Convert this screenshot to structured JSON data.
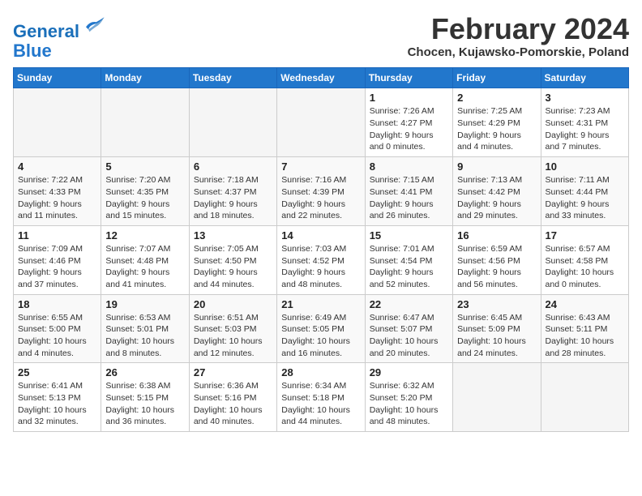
{
  "header": {
    "logo_line1": "General",
    "logo_line2": "Blue",
    "month_title": "February 2024",
    "subtitle": "Chocen, Kujawsko-Pomorskie, Poland"
  },
  "weekdays": [
    "Sunday",
    "Monday",
    "Tuesday",
    "Wednesday",
    "Thursday",
    "Friday",
    "Saturday"
  ],
  "weeks": [
    [
      {
        "day": "",
        "info": ""
      },
      {
        "day": "",
        "info": ""
      },
      {
        "day": "",
        "info": ""
      },
      {
        "day": "",
        "info": ""
      },
      {
        "day": "1",
        "info": "Sunrise: 7:26 AM\nSunset: 4:27 PM\nDaylight: 9 hours\nand 0 minutes."
      },
      {
        "day": "2",
        "info": "Sunrise: 7:25 AM\nSunset: 4:29 PM\nDaylight: 9 hours\nand 4 minutes."
      },
      {
        "day": "3",
        "info": "Sunrise: 7:23 AM\nSunset: 4:31 PM\nDaylight: 9 hours\nand 7 minutes."
      }
    ],
    [
      {
        "day": "4",
        "info": "Sunrise: 7:22 AM\nSunset: 4:33 PM\nDaylight: 9 hours\nand 11 minutes."
      },
      {
        "day": "5",
        "info": "Sunrise: 7:20 AM\nSunset: 4:35 PM\nDaylight: 9 hours\nand 15 minutes."
      },
      {
        "day": "6",
        "info": "Sunrise: 7:18 AM\nSunset: 4:37 PM\nDaylight: 9 hours\nand 18 minutes."
      },
      {
        "day": "7",
        "info": "Sunrise: 7:16 AM\nSunset: 4:39 PM\nDaylight: 9 hours\nand 22 minutes."
      },
      {
        "day": "8",
        "info": "Sunrise: 7:15 AM\nSunset: 4:41 PM\nDaylight: 9 hours\nand 26 minutes."
      },
      {
        "day": "9",
        "info": "Sunrise: 7:13 AM\nSunset: 4:42 PM\nDaylight: 9 hours\nand 29 minutes."
      },
      {
        "day": "10",
        "info": "Sunrise: 7:11 AM\nSunset: 4:44 PM\nDaylight: 9 hours\nand 33 minutes."
      }
    ],
    [
      {
        "day": "11",
        "info": "Sunrise: 7:09 AM\nSunset: 4:46 PM\nDaylight: 9 hours\nand 37 minutes."
      },
      {
        "day": "12",
        "info": "Sunrise: 7:07 AM\nSunset: 4:48 PM\nDaylight: 9 hours\nand 41 minutes."
      },
      {
        "day": "13",
        "info": "Sunrise: 7:05 AM\nSunset: 4:50 PM\nDaylight: 9 hours\nand 44 minutes."
      },
      {
        "day": "14",
        "info": "Sunrise: 7:03 AM\nSunset: 4:52 PM\nDaylight: 9 hours\nand 48 minutes."
      },
      {
        "day": "15",
        "info": "Sunrise: 7:01 AM\nSunset: 4:54 PM\nDaylight: 9 hours\nand 52 minutes."
      },
      {
        "day": "16",
        "info": "Sunrise: 6:59 AM\nSunset: 4:56 PM\nDaylight: 9 hours\nand 56 minutes."
      },
      {
        "day": "17",
        "info": "Sunrise: 6:57 AM\nSunset: 4:58 PM\nDaylight: 10 hours\nand 0 minutes."
      }
    ],
    [
      {
        "day": "18",
        "info": "Sunrise: 6:55 AM\nSunset: 5:00 PM\nDaylight: 10 hours\nand 4 minutes."
      },
      {
        "day": "19",
        "info": "Sunrise: 6:53 AM\nSunset: 5:01 PM\nDaylight: 10 hours\nand 8 minutes."
      },
      {
        "day": "20",
        "info": "Sunrise: 6:51 AM\nSunset: 5:03 PM\nDaylight: 10 hours\nand 12 minutes."
      },
      {
        "day": "21",
        "info": "Sunrise: 6:49 AM\nSunset: 5:05 PM\nDaylight: 10 hours\nand 16 minutes."
      },
      {
        "day": "22",
        "info": "Sunrise: 6:47 AM\nSunset: 5:07 PM\nDaylight: 10 hours\nand 20 minutes."
      },
      {
        "day": "23",
        "info": "Sunrise: 6:45 AM\nSunset: 5:09 PM\nDaylight: 10 hours\nand 24 minutes."
      },
      {
        "day": "24",
        "info": "Sunrise: 6:43 AM\nSunset: 5:11 PM\nDaylight: 10 hours\nand 28 minutes."
      }
    ],
    [
      {
        "day": "25",
        "info": "Sunrise: 6:41 AM\nSunset: 5:13 PM\nDaylight: 10 hours\nand 32 minutes."
      },
      {
        "day": "26",
        "info": "Sunrise: 6:38 AM\nSunset: 5:15 PM\nDaylight: 10 hours\nand 36 minutes."
      },
      {
        "day": "27",
        "info": "Sunrise: 6:36 AM\nSunset: 5:16 PM\nDaylight: 10 hours\nand 40 minutes."
      },
      {
        "day": "28",
        "info": "Sunrise: 6:34 AM\nSunset: 5:18 PM\nDaylight: 10 hours\nand 44 minutes."
      },
      {
        "day": "29",
        "info": "Sunrise: 6:32 AM\nSunset: 5:20 PM\nDaylight: 10 hours\nand 48 minutes."
      },
      {
        "day": "",
        "info": ""
      },
      {
        "day": "",
        "info": ""
      }
    ]
  ]
}
